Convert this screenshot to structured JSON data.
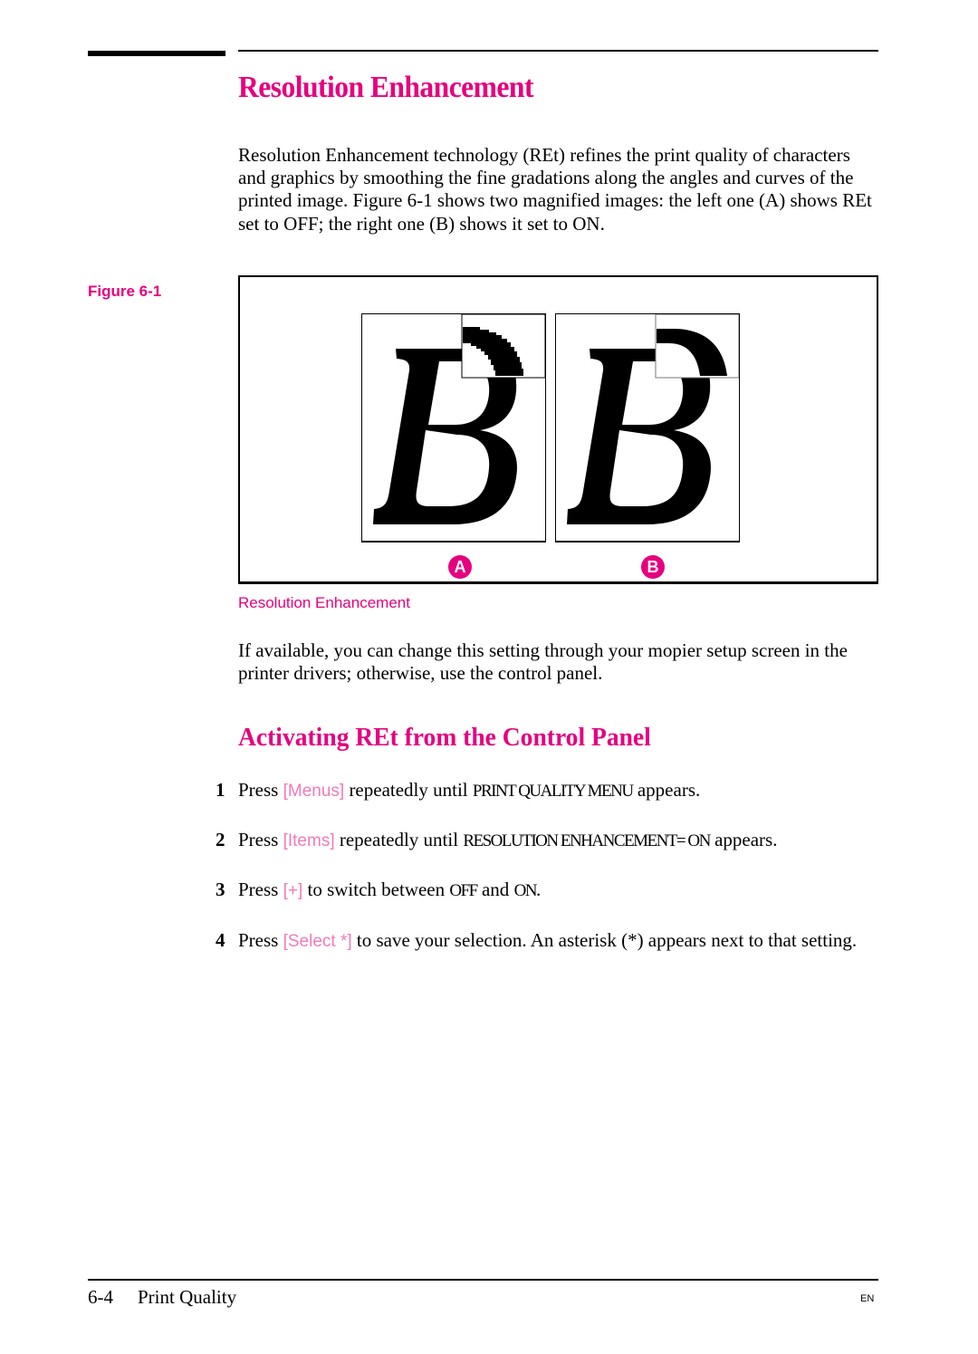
{
  "heading": "Resolution Enhancement",
  "intro_paragraph": "Resolution Enhancement technology (REt) refines the print quality of characters and graphics by smoothing the fine gradations along the angles and curves of the printed image. Figure 6-1 shows two magnified images: the left one (A) shows REt set to OFF; the right one  (B) shows it set to ON.",
  "figure": {
    "label": "Figure 6-1",
    "caption": "Resolution Enhancement",
    "panels": [
      {
        "badge": "A",
        "letter": "B",
        "setting": "OFF"
      },
      {
        "badge": "B",
        "letter": "B",
        "setting": "ON"
      }
    ]
  },
  "availability_paragraph": "If available, you can change this setting through your mopier setup screen in the printer drivers; otherwise, use the control panel.",
  "subheading": "Activating REt from the Control Panel",
  "steps": [
    {
      "num": "1",
      "pre": "Press ",
      "key": "[Menus]",
      "mid": " repeatedly until ",
      "lcd": "PRINT QUALITY MENU",
      "post": " appears."
    },
    {
      "num": "2",
      "pre": "Press ",
      "key": "[Items]",
      "mid": " repeatedly until ",
      "lcd": "RESOLUTION ENHANCEMENT= ON",
      "post": " appears."
    },
    {
      "num": "3",
      "pre": "Press ",
      "key": "[+]",
      "mid": " to switch between ",
      "lcd": "OFF",
      "mid2": " and ",
      "lcd2": "ON",
      "post": "."
    },
    {
      "num": "4",
      "pre": "Press ",
      "key": "[Select *]",
      "mid": " to save your selection. An asterisk (*) appears next to that setting.",
      "lcd": "",
      "post": ""
    }
  ],
  "footer": {
    "page_number": "6-4",
    "section": "Print Quality",
    "lang": "EN"
  },
  "colors": {
    "accent": "#e6007e",
    "key_text": "#f27ab8"
  }
}
